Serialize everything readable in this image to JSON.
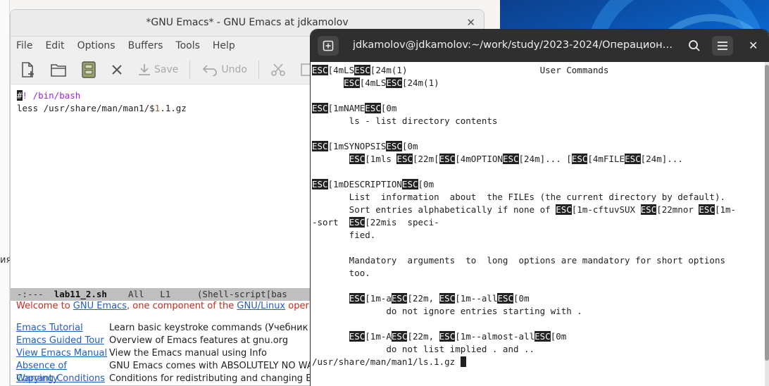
{
  "desktop": {
    "sliver_text": "ия"
  },
  "emacs": {
    "title": "*GNU Emacs* - GNU Emacs at jdkamolov",
    "menu": [
      "File",
      "Edit",
      "Options",
      "Buffers",
      "Tools",
      "Help"
    ],
    "toolbar": {
      "save": "Save",
      "undo": "Undo"
    },
    "editor_lines": [
      {
        "cursor": "#",
        "kw": "! /bin/bash",
        "rest": ""
      },
      {
        "pre": "less /usr/share/man/man1/$",
        "var": "1",
        "post": ".1.gz"
      }
    ],
    "modeline": {
      "status": "-:---  ",
      "buffer": "lab11_2.sh",
      "pos": "    All   L1     ",
      "mode": "(Shell-script[bas"
    },
    "welcome": {
      "intro_pre": "Welcome to ",
      "intro_link1": "GNU Emacs",
      "intro_mid": ", one component of the ",
      "intro_link2": "GNU/Linux",
      "intro_post": " operating",
      "rows": [
        {
          "link": "Emacs Tutorial",
          "desc": "Learn basic keystroke commands (Учебник Ema"
        },
        {
          "link": "Emacs Guided Tour",
          "desc": "Overview of Emacs features at gnu.org"
        },
        {
          "link": "View Emacs Manual",
          "desc": "View the Emacs manual using Info"
        },
        {
          "link": "Absence of Warranty",
          "desc": "GNU Emacs comes with ABSOLUTELY NO WARRANTY"
        },
        {
          "link": "Copying Conditions",
          "desc": "Conditions for redistributing and changing Emacs"
        }
      ]
    }
  },
  "terminal": {
    "title": "jdkamolov@jdkamolov:~/work/study/2023-2024/Операционн...",
    "esc_token": "ESC",
    "prompt_line": "/usr/share/man/man1/ls.1.gz ",
    "lines": [
      [
        [
          "t",
          "["
        ],
        [
          "t",
          "4mLS"
        ],
        [
          "e"
        ],
        [
          "t",
          "[24m(1)                         User Commands"
        ]
      ],
      [
        [
          "t",
          "      "
        ],
        [
          "e"
        ],
        [
          "t",
          "[4mLS"
        ],
        [
          "e"
        ],
        [
          "t",
          "[24m(1)"
        ]
      ],
      [],
      [
        [
          "e"
        ],
        [
          "t",
          "[1mNAME"
        ],
        [
          "e"
        ],
        [
          "t",
          "[0m"
        ]
      ],
      [
        [
          "t",
          "       ls - list directory contents"
        ]
      ],
      [],
      [
        [
          "e"
        ],
        [
          "t",
          "[1mSYNOPSIS"
        ],
        [
          "e"
        ],
        [
          "t",
          "[0m"
        ]
      ],
      [
        [
          "t",
          "       "
        ],
        [
          "e"
        ],
        [
          "t",
          "[1mls "
        ],
        [
          "e"
        ],
        [
          "t",
          "[22m["
        ],
        [
          "e"
        ],
        [
          "t",
          "[4mOPTION"
        ],
        [
          "e"
        ],
        [
          "t",
          "[24m]... ["
        ],
        [
          "e"
        ],
        [
          "t",
          "[4mFILE"
        ],
        [
          "e"
        ],
        [
          "t",
          "[24m]..."
        ]
      ],
      [],
      [
        [
          "e"
        ],
        [
          "t",
          "[1mDESCRIPTION"
        ],
        [
          "e"
        ],
        [
          "t",
          "[0m"
        ]
      ],
      [
        [
          "t",
          "       List  information  about  the FILEs (the current directory by default)."
        ]
      ],
      [
        [
          "t",
          "       Sort entries alphabetically if none of "
        ],
        [
          "e"
        ],
        [
          "t",
          "[1m-cftuvSUX "
        ],
        [
          "e"
        ],
        [
          "t",
          "[22mnor "
        ],
        [
          "e"
        ],
        [
          "t",
          "[1m-"
        ]
      ],
      [
        [
          "t",
          "-sort  "
        ],
        [
          "e"
        ],
        [
          "t",
          "[22mis  speci-"
        ]
      ],
      [
        [
          "t",
          "       fied."
        ]
      ],
      [],
      [
        [
          "t",
          "       Mandatory  arguments  to  long  options are mandatory for short options"
        ]
      ],
      [
        [
          "t",
          "       too."
        ]
      ],
      [],
      [
        [
          "t",
          "       "
        ],
        [
          "e"
        ],
        [
          "t",
          "[1m-a"
        ],
        [
          "e"
        ],
        [
          "t",
          "[22m, "
        ],
        [
          "e"
        ],
        [
          "t",
          "[1m--all"
        ],
        [
          "e"
        ],
        [
          "t",
          "[0m"
        ]
      ],
      [
        [
          "t",
          "              do not ignore entries starting with ."
        ]
      ],
      [],
      [
        [
          "t",
          "       "
        ],
        [
          "e"
        ],
        [
          "t",
          "[1m-A"
        ],
        [
          "e"
        ],
        [
          "t",
          "[22m, "
        ],
        [
          "e"
        ],
        [
          "t",
          "[1m--almost-all"
        ],
        [
          "e"
        ],
        [
          "t",
          "[0m"
        ]
      ],
      [
        [
          "t",
          "              do not list implied . and .."
        ]
      ]
    ]
  }
}
